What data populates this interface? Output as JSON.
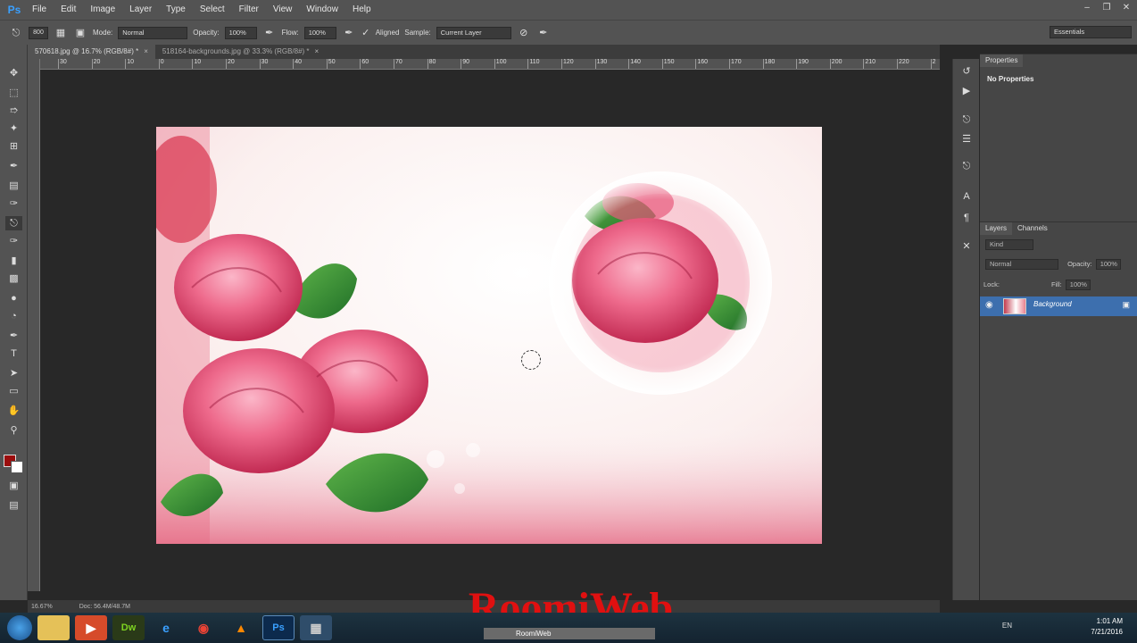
{
  "app": {
    "logo": "Ps"
  },
  "menu": [
    "File",
    "Edit",
    "Image",
    "Layer",
    "Type",
    "Select",
    "Filter",
    "View",
    "Window",
    "Help"
  ],
  "options": {
    "brush_size": "800",
    "mode_label": "Mode:",
    "mode_value": "Normal",
    "opacity_label": "Opacity:",
    "opacity_value": "100%",
    "flow_label": "Flow:",
    "flow_value": "100%",
    "aligned_label": "Aligned",
    "sample_label": "Sample:",
    "sample_value": "Current Layer",
    "workspace": "Essentials"
  },
  "tabs": [
    {
      "label": "570618.jpg @ 16.7% (RGB/8#) *"
    },
    {
      "label": "518164-backgrounds.jpg @ 33.3% (RGB/8#) *"
    }
  ],
  "ruler_ticks": [
    "30",
    "20",
    "10",
    "0",
    "10",
    "20",
    "30",
    "40",
    "50",
    "60",
    "70",
    "80",
    "90",
    "100",
    "110",
    "120",
    "130",
    "140",
    "150",
    "160",
    "170",
    "180",
    "190",
    "200",
    "210",
    "220",
    "2"
  ],
  "status": {
    "zoom": "16.67%",
    "doc": "Doc: 56.4M/48.7M"
  },
  "properties": {
    "tab": "Properties",
    "empty_text": "No Properties"
  },
  "layers": {
    "tabs": [
      "Layers",
      "Channels"
    ],
    "kind": "Kind",
    "blend": "Normal",
    "opacity_label": "Opacity:",
    "opacity_value": "100%",
    "lock_label": "Lock:",
    "fill_label": "Fill:",
    "fill_value": "100%",
    "items": [
      {
        "name": "Background"
      }
    ]
  },
  "watermark": {
    "text": "RoomiWeb",
    "sub": "RoomiWeb"
  },
  "taskbar": {
    "time": "1:01 AM",
    "date": "7/21/2016",
    "lang": "EN"
  },
  "colors": {
    "foreground": "#9b0d0d",
    "background": "#ffffff",
    "accent": "#3d6fae"
  }
}
